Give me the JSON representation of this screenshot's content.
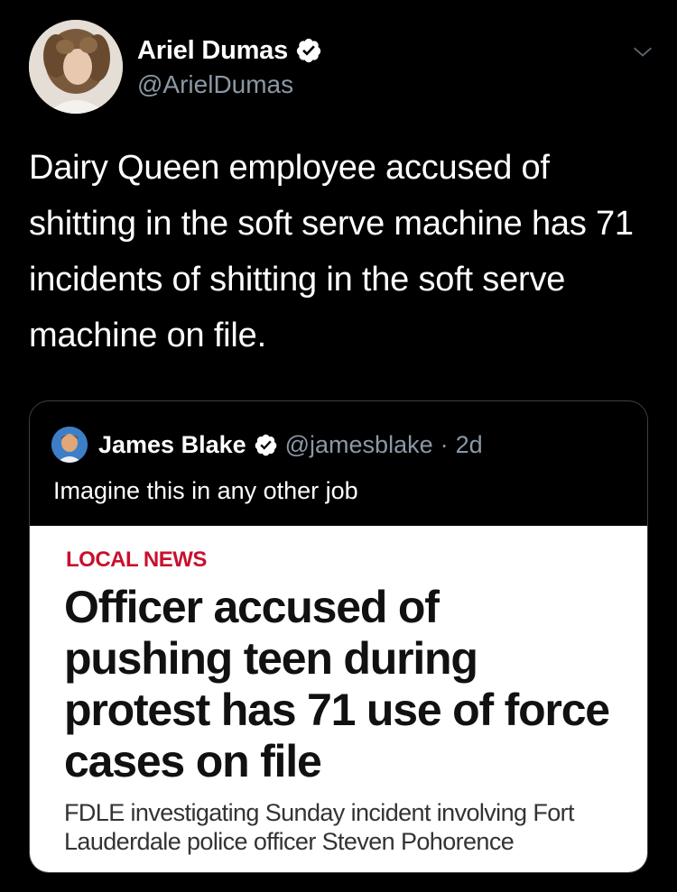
{
  "tweet": {
    "author": {
      "display_name": "Ariel Dumas",
      "handle": "@ArielDumas",
      "verified": true,
      "avatar_icon": "profile-photo"
    },
    "menu_icon": "chevron-down-icon",
    "text": "Dairy Queen employee accused of shitting in the soft serve machine has 71 incidents of shitting in the soft serve machine on file."
  },
  "quoted_tweet": {
    "author": {
      "display_name": "James Blake",
      "handle": "@jamesblake",
      "verified": true
    },
    "separator": "·",
    "time": "2d",
    "text": "Imagine this in any other job",
    "image": {
      "kicker": "LOCAL NEWS",
      "headline": "Officer accused of pushing teen during protest has 71 use of force cases on file",
      "subheadline": "FDLE investigating Sunday incident involving Fort Lauderdale police officer Steven Pohorence"
    }
  },
  "colors": {
    "background": "#000000",
    "text": "#ffffff",
    "secondary_text": "#8b98a5",
    "border": "#3d4045",
    "verified_badge": "#ffffff",
    "kicker_red": "#c8102e"
  }
}
